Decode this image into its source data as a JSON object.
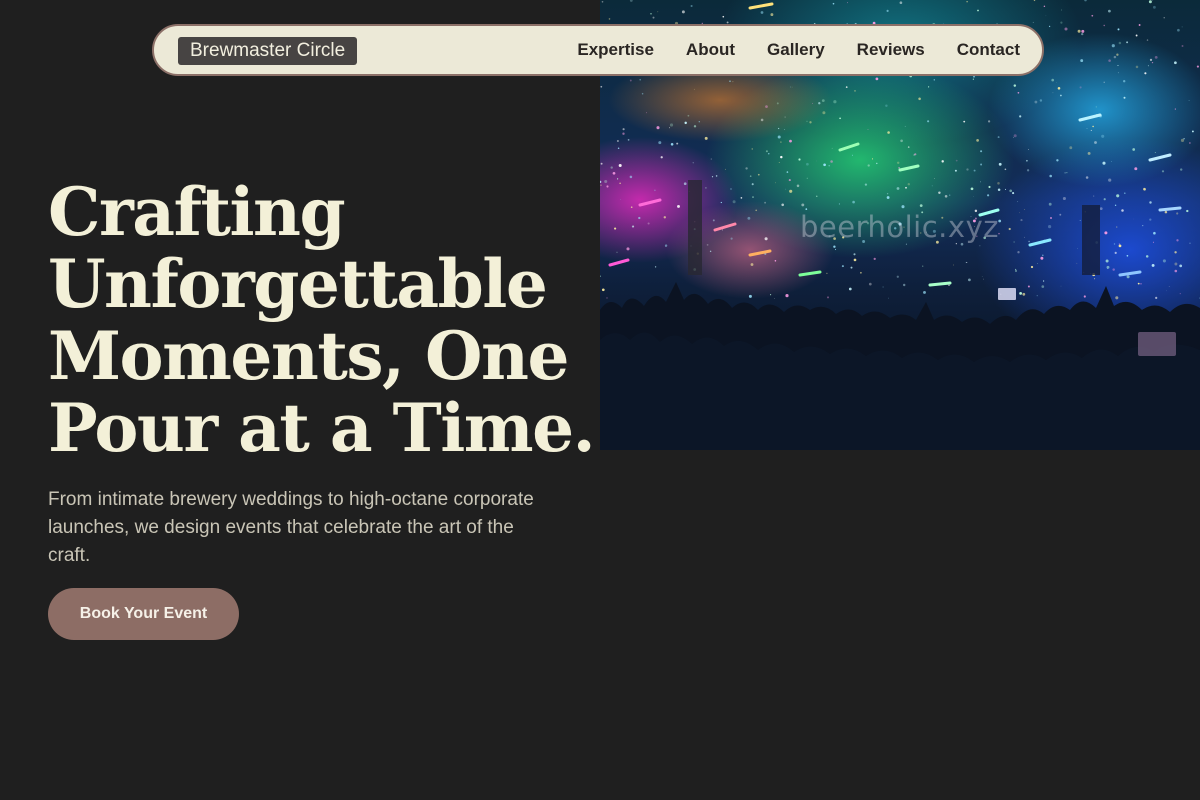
{
  "nav": {
    "brand": "Brewmaster Circle",
    "links": [
      {
        "label": "Expertise"
      },
      {
        "label": "About"
      },
      {
        "label": "Gallery"
      },
      {
        "label": "Reviews"
      },
      {
        "label": "Contact"
      }
    ]
  },
  "hero": {
    "headline": "Crafting Unforgettable Moments, One Pour at a Time.",
    "subtext": "From intimate brewery weddings to high-octane corporate launches, we design events that celebrate the art of the craft.",
    "cta_label": "Book Your Event",
    "image_watermark": "beerholic.xyz"
  },
  "colors": {
    "background": "#1f1f1f",
    "navbar_bg": "#ece9d7",
    "navbar_border": "#8c7068",
    "brand_bg": "#474443",
    "headline": "#f3f0d8",
    "cta_bg": "#8d6d65"
  }
}
